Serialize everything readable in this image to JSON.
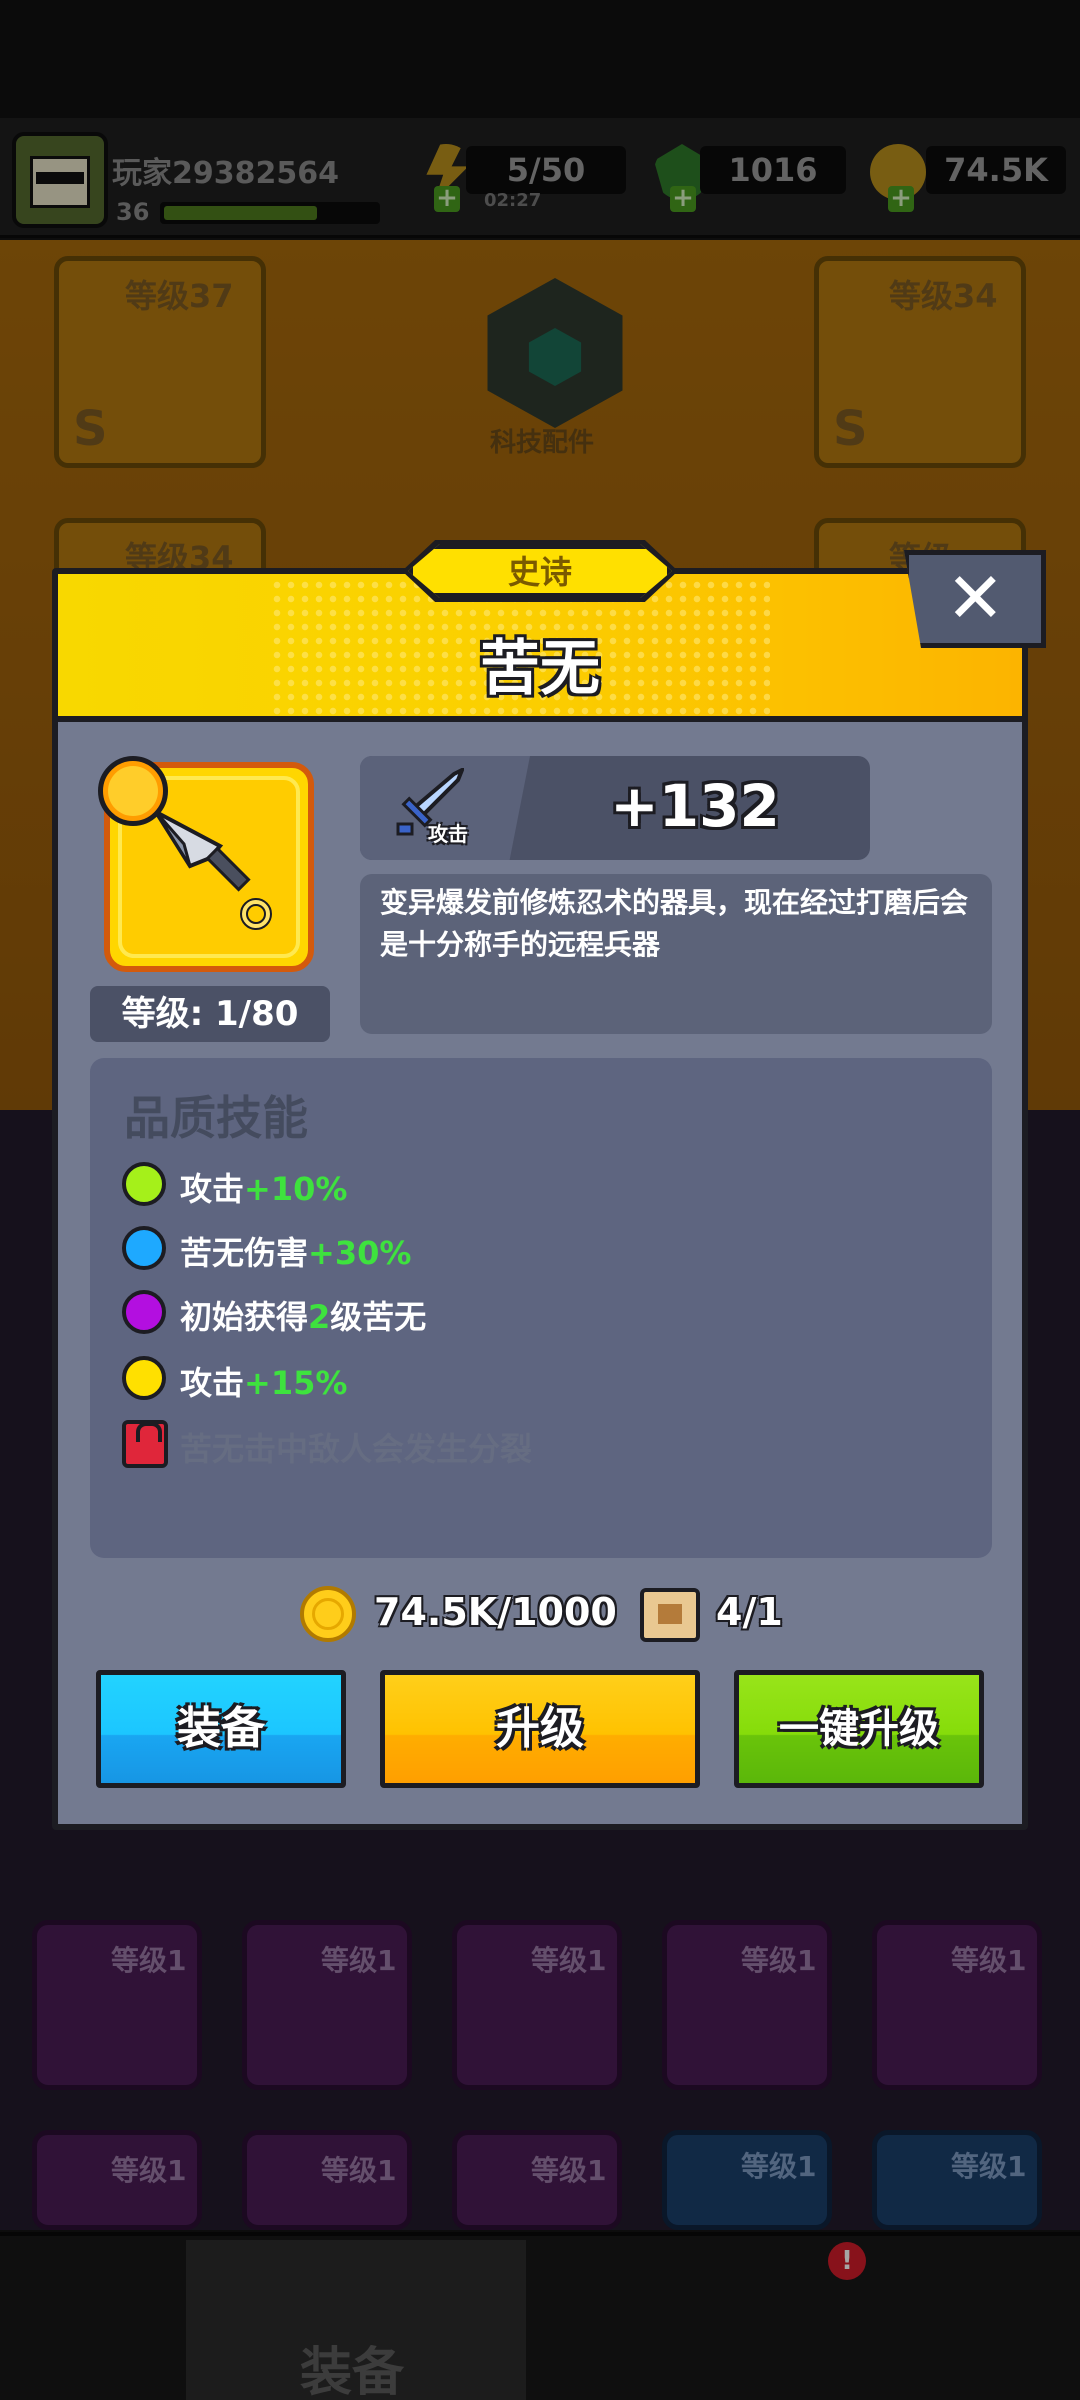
{
  "player": {
    "name": "玩家29382564",
    "level": "36",
    "xp_fraction": 0.72
  },
  "resources": {
    "energy": "5/50",
    "energy_timer": "02:27",
    "gems": "1016",
    "gold": "74.5K"
  },
  "background": {
    "slots": [
      {
        "label": "等级37",
        "grade": "S"
      },
      {
        "label": "等级34",
        "grade": "S"
      },
      {
        "label": "等级34"
      },
      {
        "label": "等级"
      }
    ],
    "tech_label": "科技配件",
    "grid_labels": [
      "等级1",
      "等级1",
      "等级1",
      "等级1",
      "等级1",
      "等级1",
      "等级1",
      "等级1",
      "等级1",
      "等级1"
    ],
    "nav_active_label": "装备"
  },
  "modal": {
    "rarity": "史诗",
    "title": "苦无",
    "close": "✕",
    "level_text": "等级: 1/80",
    "stat": {
      "label": "攻击",
      "value": "+132"
    },
    "description": "变异爆发前修炼忍术的器具，现在经过打磨后会是十分称手的远程兵器",
    "skills_title": "品质技能",
    "skills": [
      {
        "name": "攻击",
        "bonus": "+10%",
        "suffix": "",
        "color": "#a5f01a",
        "locked": false
      },
      {
        "name": "苦无伤害",
        "bonus": "+30%",
        "suffix": "",
        "color": "#1ea9ff",
        "locked": false
      },
      {
        "name": "初始获得",
        "bonus": "2",
        "suffix": "级苦无",
        "color": "#b30fe0",
        "locked": false
      },
      {
        "name": "攻击",
        "bonus": "+15%",
        "suffix": "",
        "color": "#ffe000",
        "locked": false
      },
      {
        "name": "苦无击中敌人会发生分裂",
        "bonus": "",
        "suffix": "",
        "color": "#e0263a",
        "locked": true
      }
    ],
    "cost_gold": "74.5K/1000",
    "cost_scroll": "4/1",
    "buttons": {
      "equip": "装备",
      "upgrade": "升级",
      "one_click": "一键升级"
    }
  },
  "colors": {
    "header_yellow": "#fbd000",
    "panel_gray": "#737a90",
    "bonus_green": "#3ee23e"
  }
}
